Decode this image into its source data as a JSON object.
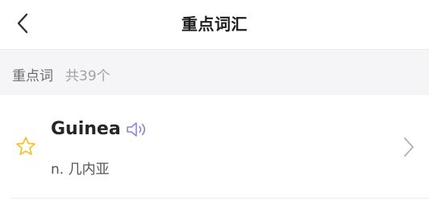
{
  "header": {
    "title": "重点词汇",
    "back_icon": "chevron-left-icon"
  },
  "section": {
    "label": "重点词",
    "count_text": "共39个"
  },
  "words": [
    {
      "word": "Guinea",
      "definition": "n. 几内亚",
      "star_icon": "star-outline-icon",
      "speaker_icon": "speaker-icon",
      "chevron_icon": "chevron-right-icon"
    }
  ],
  "colors": {
    "star": "#f2c230",
    "speaker": "#8b85d9",
    "section_bg": "#f5f5f7"
  }
}
